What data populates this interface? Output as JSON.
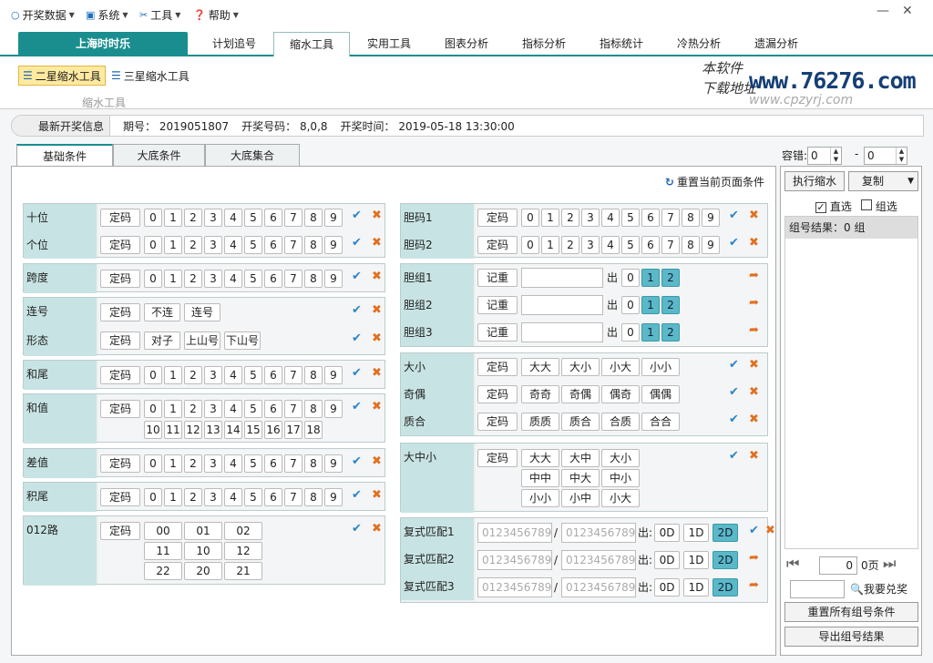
{
  "menu": {
    "items": [
      {
        "label": "开奖数据",
        "icon": "circle-icon"
      },
      {
        "label": "系统",
        "icon": "monitor-icon"
      },
      {
        "label": "工具",
        "icon": "tools-icon"
      },
      {
        "label": "帮助",
        "icon": "help-icon"
      }
    ],
    "minimize": "—",
    "close": "✕"
  },
  "tabs": {
    "brand": "上海时时乐",
    "items": [
      "计划追号",
      "缩水工具",
      "实用工具",
      "图表分析",
      "指标分析",
      "指标统计",
      "冷热分析",
      "遗漏分析"
    ],
    "active": "缩水工具"
  },
  "tools": {
    "two_star": "二星缩水工具",
    "three_star": "三星缩水工具",
    "group": "缩水工具"
  },
  "logo": {
    "line1": "本软件",
    "line2": "下载地址",
    "url": "www.76276.com",
    "url2": "www.cpzyrj.com"
  },
  "info": {
    "caption": "最新开奖信息",
    "period": "期号： 2019051807",
    "numbers": "开奖号码： 8,0,8",
    "time": "开奖时间： 2019-05-18 13:30:00"
  },
  "content_tabs": [
    "基础条件",
    "大底条件",
    "大底集合"
  ],
  "reset_page": "重置当前页面条件",
  "digits": [
    "0",
    "1",
    "2",
    "3",
    "4",
    "5",
    "6",
    "7",
    "8",
    "9"
  ],
  "sum_ext": [
    "10",
    "11",
    "12",
    "13",
    "14",
    "15",
    "16",
    "17",
    "18"
  ],
  "dingma": "定码",
  "jima": "记重",
  "chu": "出",
  "left_rows": {
    "shiwei": "十位",
    "gewei": "个位",
    "kuadu": "跨度",
    "lianhao": "连号",
    "xingtai": "形态",
    "hewei": "和尾",
    "hezhi": "和值",
    "chazhi": "差值",
    "jiwei": "积尾",
    "lu012": "012路"
  },
  "lianhao_opts": [
    "不连",
    "连号"
  ],
  "xingtai_opts": [
    "对子",
    "上山号",
    "下山号"
  ],
  "lu_opts": [
    "00",
    "01",
    "02",
    "11",
    "10",
    "12",
    "22",
    "20",
    "21"
  ],
  "right_rows": {
    "danma1": "胆码1",
    "danma2": "胆码2",
    "danzu1": "胆组1",
    "danzu2": "胆组2",
    "danzu3": "胆组3",
    "daxiao": "大小",
    "jiou": "奇偶",
    "zhihe": "质合",
    "dazhongxiao": "大中小",
    "fushi1": "复式匹配1",
    "fushi2": "复式匹配2",
    "fushi3": "复式匹配3"
  },
  "chu_opts": [
    "0",
    "1",
    "2"
  ],
  "daxiao_opts": [
    "大大",
    "大小",
    "小大",
    "小小"
  ],
  "jiou_opts": [
    "奇奇",
    "奇偶",
    "偶奇",
    "偶偶"
  ],
  "zhihe_opts": [
    "质质",
    "质合",
    "合质",
    "合合"
  ],
  "dzx_opts": [
    "大大",
    "大中",
    "大小",
    "中中",
    "中大",
    "中小",
    "小小",
    "小中",
    "小大"
  ],
  "fushi": {
    "placeholder": "0123456789",
    "slash": "/",
    "chu": "出:",
    "opts": [
      "0D",
      "1D",
      "2D"
    ]
  },
  "sidebar": {
    "tolerance_label": "容错:",
    "tol_from": "0",
    "tol_to": "0",
    "dash": "-",
    "execute": "执行缩水",
    "copy": "复制",
    "zhixuan": "直选",
    "zuxuan": "组选",
    "result": "组号结果：0 组",
    "page_val": "0",
    "page_suffix": "0页",
    "prize": "我要兑奖",
    "reset_all": "重置所有组号条件",
    "export": "导出组号结果"
  },
  "colors": {
    "accent": "#1a8e8e",
    "label_bg": "#c8e3e3",
    "selected": "#5ab8c8",
    "check": "#2a85c8",
    "clear": "#e0701f"
  }
}
